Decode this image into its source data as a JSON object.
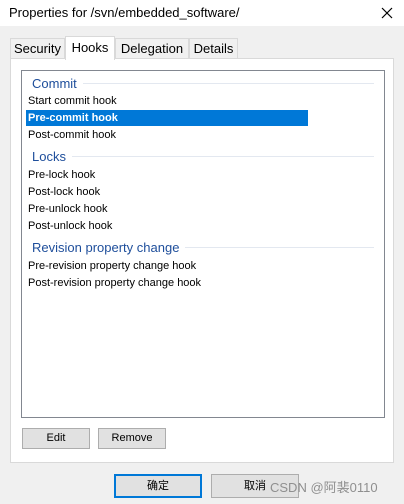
{
  "window": {
    "title": "Properties for /svn/embedded_software/"
  },
  "tabs": [
    {
      "label": "Security",
      "active": false
    },
    {
      "label": "Hooks",
      "active": true
    },
    {
      "label": "Delegation",
      "active": false
    },
    {
      "label": "Details",
      "active": false
    }
  ],
  "hooks_list": {
    "groups": [
      {
        "header": "Commit",
        "items": [
          "Start commit hook",
          "Pre-commit hook",
          "Post-commit hook"
        ]
      },
      {
        "header": "Locks",
        "items": [
          "Pre-lock hook",
          "Post-lock hook",
          "Pre-unlock hook",
          "Post-unlock hook"
        ]
      },
      {
        "header": "Revision property change",
        "items": [
          "Pre-revision property change hook",
          "Post-revision property change hook"
        ]
      }
    ],
    "selected_item": "Pre-commit hook"
  },
  "actions": {
    "edit_label": "Edit",
    "remove_label": "Remove"
  },
  "dialog_buttons": {
    "ok_label": "确定",
    "cancel_label": "取消"
  },
  "watermark": "CSDN @阿裴0110",
  "colors": {
    "selection": "#0078d7",
    "group_header": "#1e4e9b",
    "dialog_background": "#f0f0f0"
  }
}
